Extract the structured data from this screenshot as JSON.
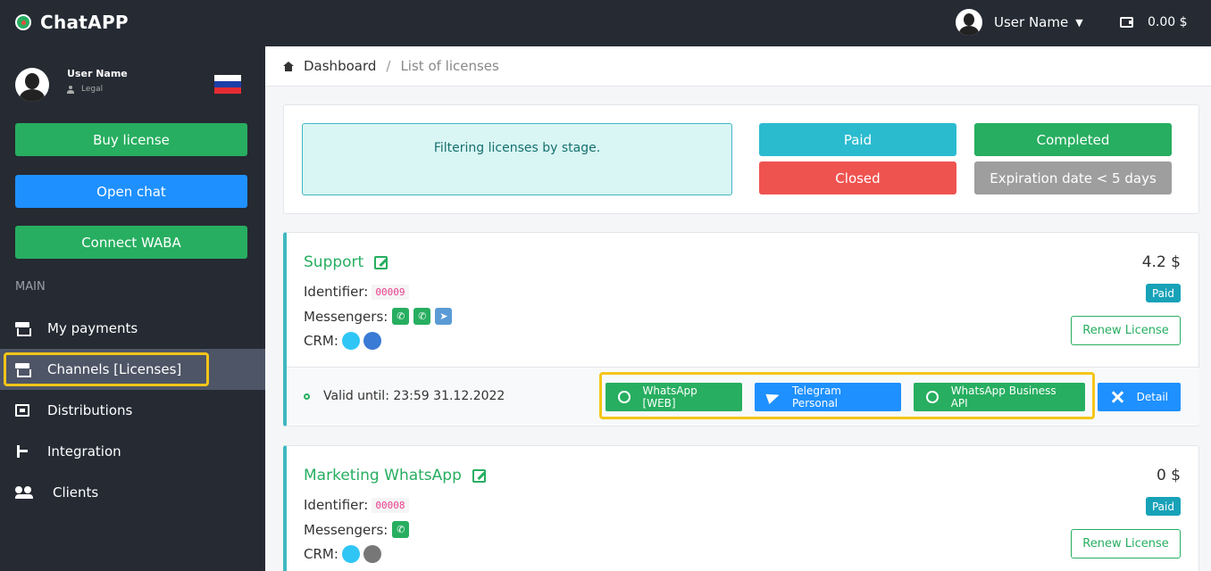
{
  "app": {
    "title": "ChatAPP"
  },
  "topbar": {
    "user_name": "User Name",
    "balance": "0.00 $"
  },
  "sidebar": {
    "user_name": "User Name",
    "user_role": "Legal",
    "buttons": {
      "buy": "Buy license",
      "open_chat": "Open chat",
      "connect_waba": "Connect WABA"
    },
    "section": "MAIN",
    "items": [
      {
        "label": "My payments"
      },
      {
        "label": "Channels [Licenses]"
      },
      {
        "label": "Distributions"
      },
      {
        "label": "Integration"
      },
      {
        "label": "Clients"
      }
    ]
  },
  "breadcrumb": {
    "home": "Dashboard",
    "current": "List of licenses"
  },
  "filter": {
    "info": "Filtering licenses by stage.",
    "stages": {
      "paid": "Paid",
      "completed": "Completed",
      "closed": "Closed",
      "expiring": "Expiration date < 5 days"
    }
  },
  "licenses": [
    {
      "name": "Support",
      "identifier_label": "Identifier:",
      "identifier": "00009",
      "messengers_label": "Messengers:",
      "crm_label": "CRM:",
      "price": "4.2 $",
      "status": "Paid",
      "renew": "Renew License",
      "valid_until": "Valid until: 23:59 31.12.2022",
      "actions": {
        "wa_web": "WhatsApp [WEB]",
        "telegram": "Telegram Personal",
        "wa_api": "WhatsApp Business API",
        "detail": "Detail"
      }
    },
    {
      "name": "Marketing WhatsApp",
      "identifier_label": "Identifier:",
      "identifier": "00008",
      "messengers_label": "Messengers:",
      "crm_label": "CRM:",
      "price": "0 $",
      "status": "Paid",
      "renew": "Renew License"
    }
  ],
  "colors": {
    "green": "#27ae60",
    "blue": "#1e90ff",
    "cyan": "#2bbbcf",
    "red": "#ef5350",
    "gray": "#9e9e9e",
    "highlight": "#f5c518"
  }
}
